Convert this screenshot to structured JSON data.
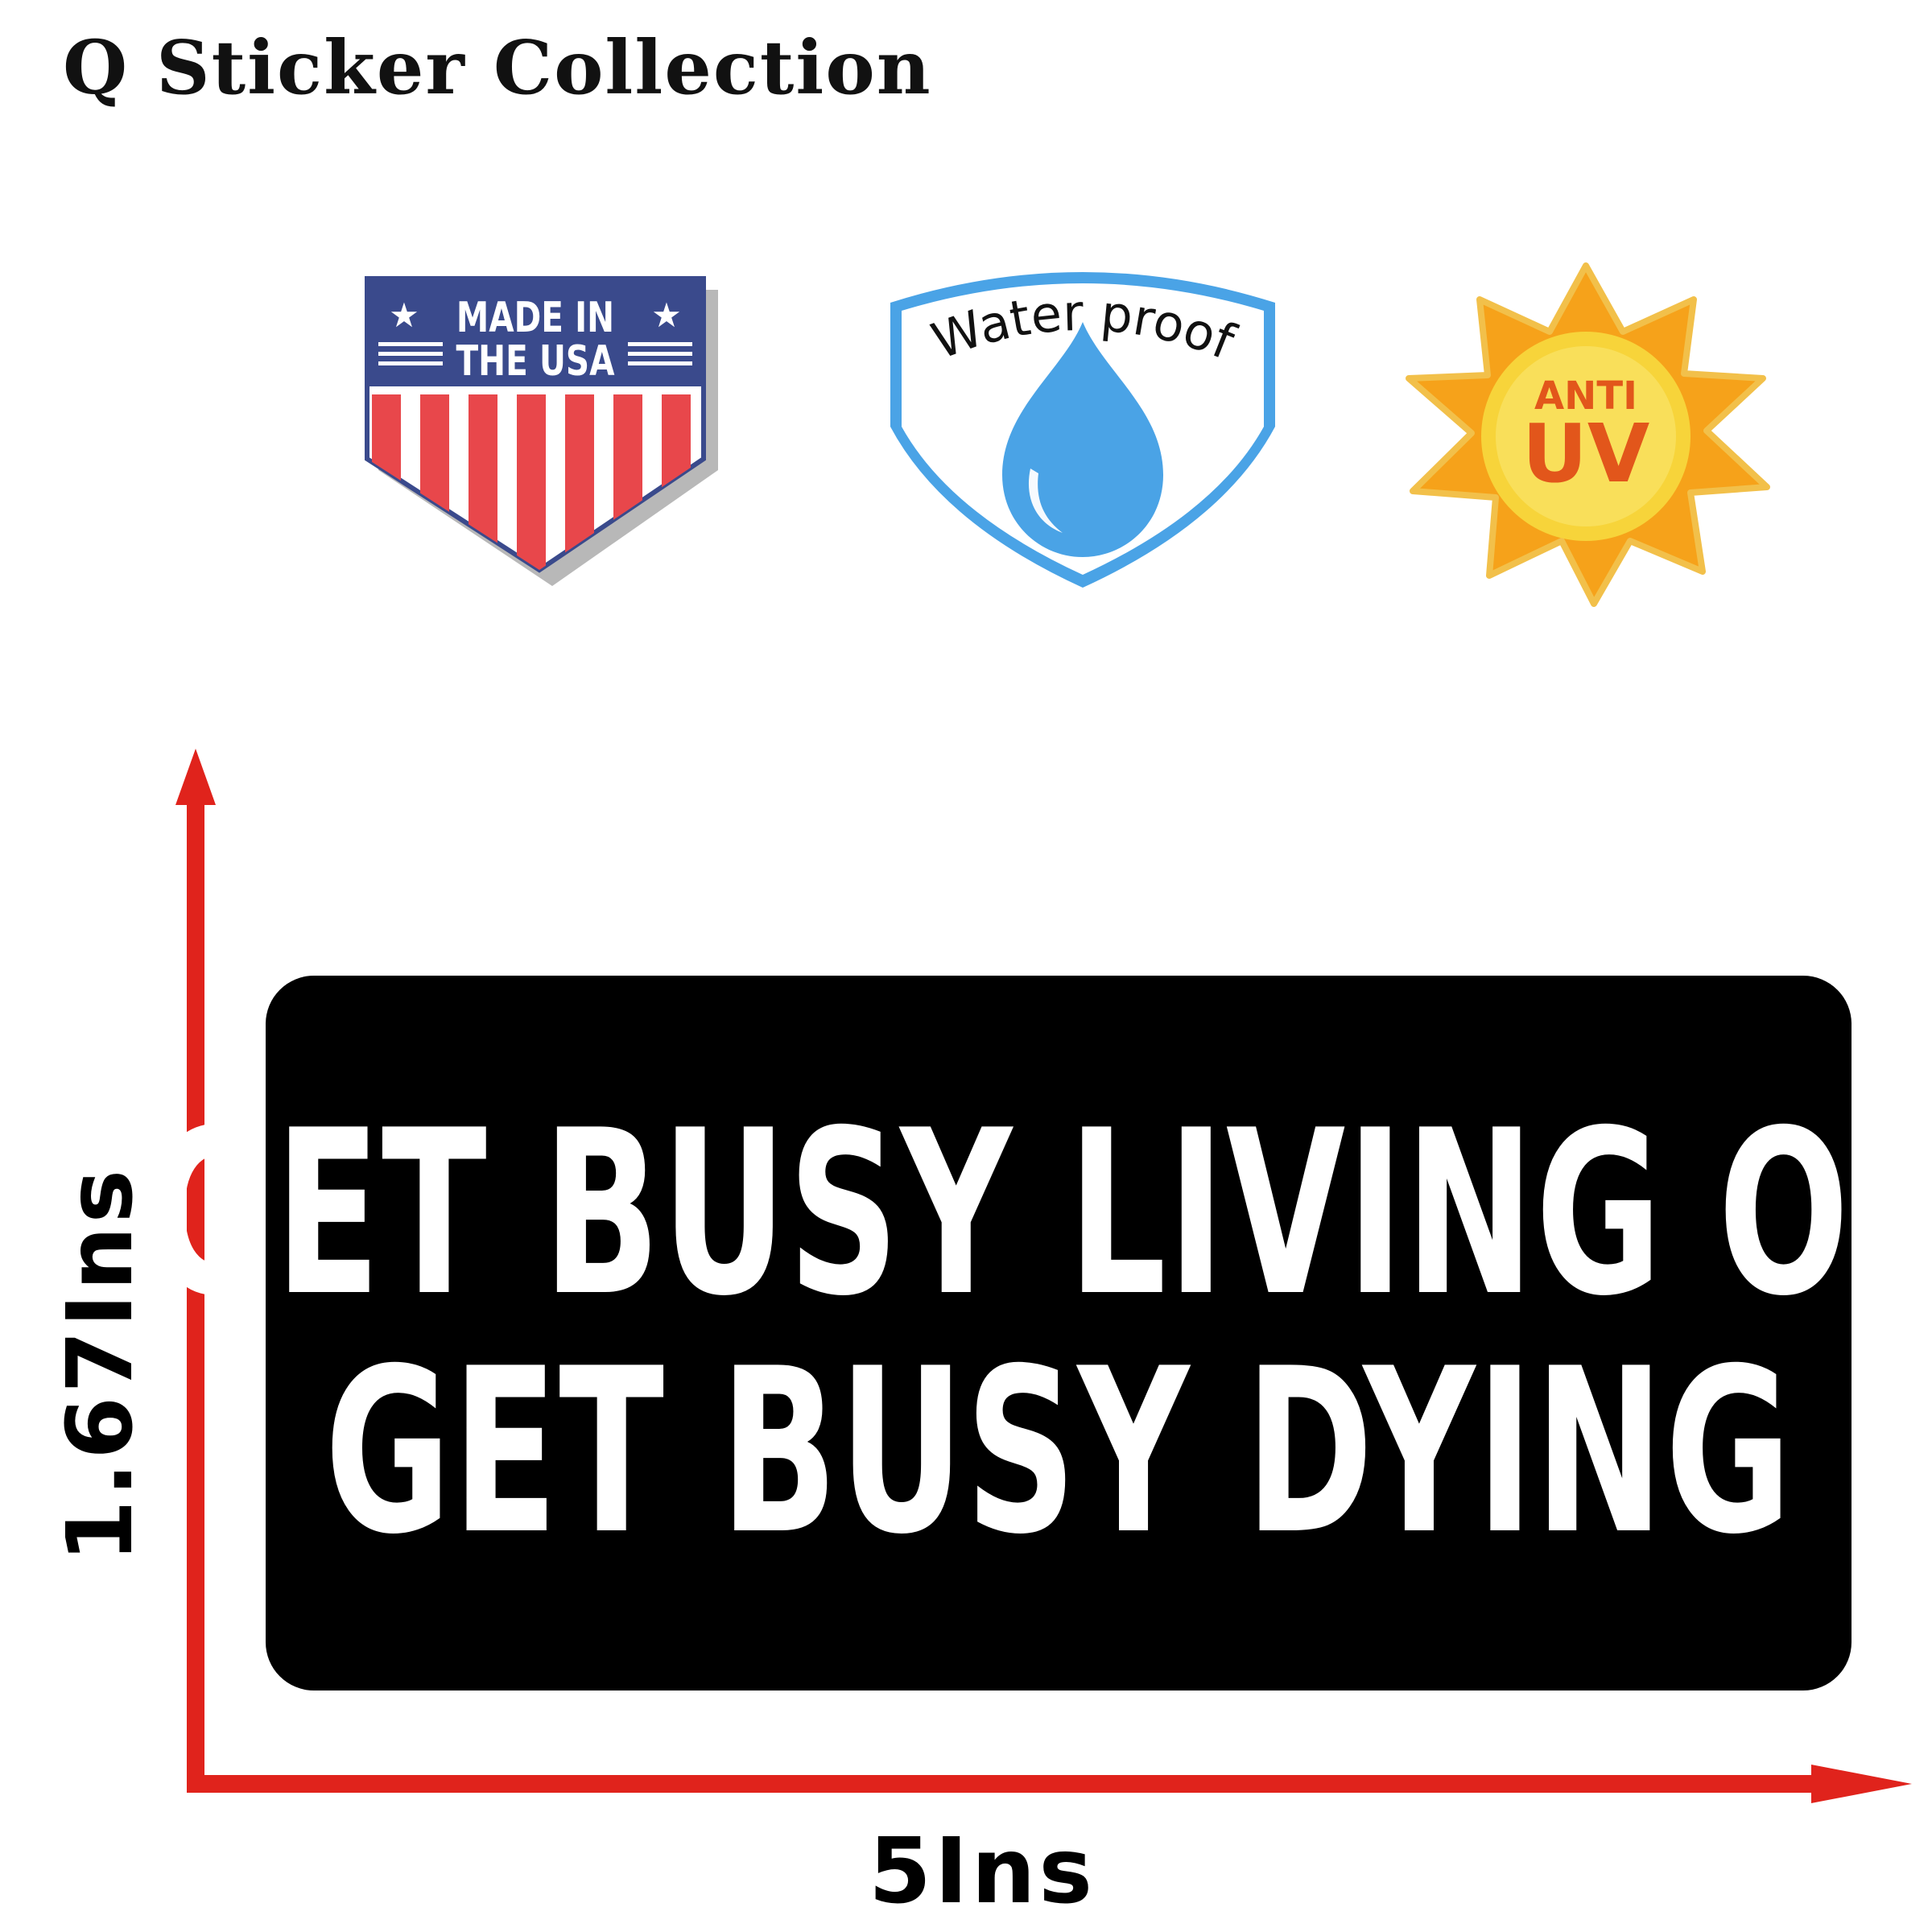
{
  "brand": {
    "title": "Q Sticker Collection"
  },
  "badges": {
    "usa": {
      "line1": "MADE IN",
      "line2": "THE USA"
    },
    "waterproof": {
      "text": "Water proof"
    },
    "anti_uv": {
      "line1": "ANTI",
      "line2": "UV"
    }
  },
  "sticker": {
    "line1": "GET BUSY LIVING OR",
    "line2": "GET BUSY DYING"
  },
  "dimensions": {
    "height": "1.67Ins",
    "width": "5Ins"
  },
  "colors": {
    "arrow": "#e0231c",
    "usa_blue": "#3a4a8c",
    "usa_red": "#e8474b",
    "water_blue": "#4aa3e6",
    "sun_orange": "#f6a21a",
    "uv_text": "#e2561b"
  }
}
